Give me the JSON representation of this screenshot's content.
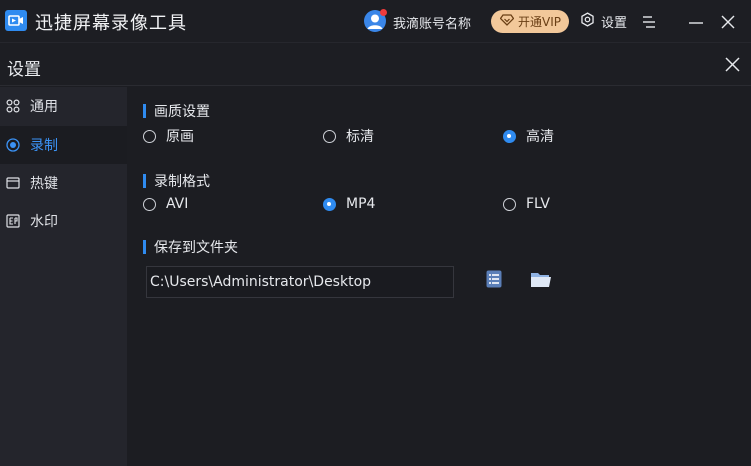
{
  "app": {
    "title": "迅捷屏幕录像工具",
    "user_name": "我滴账号名称",
    "vip_label": "开通VIP",
    "settings_label": "设置",
    "colors": {
      "accent": "#2f8bf0",
      "vip_bg": "#f2c89a",
      "notification": "#ef3b3b"
    }
  },
  "settings": {
    "title": "设置",
    "nav": [
      {
        "label": "通用",
        "icon": "grid-icon"
      },
      {
        "label": "录制",
        "icon": "record-icon"
      },
      {
        "label": "热键",
        "icon": "keyboard-icon"
      },
      {
        "label": "水印",
        "icon": "watermark-icon"
      }
    ],
    "active_nav": "录制",
    "quality": {
      "title": "画质设置",
      "options": [
        "原画",
        "标清",
        "高清"
      ],
      "selected": "高清"
    },
    "format": {
      "title": "录制格式",
      "options": [
        "AVI",
        "MP4",
        "FLV"
      ],
      "selected": "MP4"
    },
    "save": {
      "title": "保存到文件夹",
      "path": "C:\\Users\\Administrator\\Desktop"
    }
  }
}
